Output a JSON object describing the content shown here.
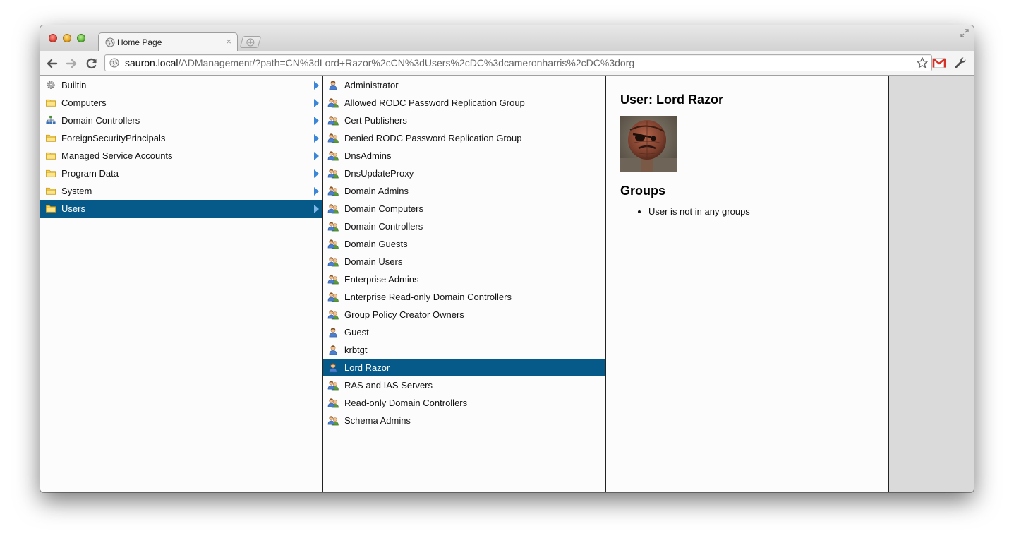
{
  "browser": {
    "tab": {
      "title": "Home Page",
      "close_glyph": "×"
    },
    "address": {
      "host": "sauron.local",
      "path": "/ADManagement/?path=CN%3dLord+Razor%2cCN%3dUsers%2cDC%3dcameronharris%2cDC%3dorg"
    }
  },
  "colors": {
    "selection": "#055a89",
    "arrow": "#3b86d6"
  },
  "containers": [
    {
      "label": "Builtin",
      "icon": "gear-icon"
    },
    {
      "label": "Computers",
      "icon": "folder-icon"
    },
    {
      "label": "Domain Controllers",
      "icon": "org-chart-icon"
    },
    {
      "label": "ForeignSecurityPrincipals",
      "icon": "folder-icon"
    },
    {
      "label": "Managed Service Accounts",
      "icon": "folder-icon"
    },
    {
      "label": "Program Data",
      "icon": "folder-icon"
    },
    {
      "label": "System",
      "icon": "folder-icon"
    },
    {
      "label": "Users",
      "icon": "folder-icon",
      "selected": true
    }
  ],
  "objects": [
    {
      "label": "Administrator",
      "icon": "user-icon"
    },
    {
      "label": "Allowed RODC Password Replication Group",
      "icon": "group-icon"
    },
    {
      "label": "Cert Publishers",
      "icon": "group-icon"
    },
    {
      "label": "Denied RODC Password Replication Group",
      "icon": "group-icon"
    },
    {
      "label": "DnsAdmins",
      "icon": "group-icon"
    },
    {
      "label": "DnsUpdateProxy",
      "icon": "group-icon"
    },
    {
      "label": "Domain Admins",
      "icon": "group-icon"
    },
    {
      "label": "Domain Computers",
      "icon": "group-icon"
    },
    {
      "label": "Domain Controllers",
      "icon": "group-icon"
    },
    {
      "label": "Domain Guests",
      "icon": "group-icon"
    },
    {
      "label": "Domain Users",
      "icon": "group-icon"
    },
    {
      "label": "Enterprise Admins",
      "icon": "group-icon"
    },
    {
      "label": "Enterprise Read-only Domain Controllers",
      "icon": "group-icon"
    },
    {
      "label": "Group Policy Creator Owners",
      "icon": "group-icon"
    },
    {
      "label": "Guest",
      "icon": "user-icon"
    },
    {
      "label": "krbtgt",
      "icon": "user-icon"
    },
    {
      "label": "Lord Razor",
      "icon": "user-icon",
      "selected": true
    },
    {
      "label": "RAS and IAS Servers",
      "icon": "group-icon"
    },
    {
      "label": "Read-only Domain Controllers",
      "icon": "group-icon"
    },
    {
      "label": "Schema Admins",
      "icon": "group-icon"
    }
  ],
  "detail": {
    "title": "User: Lord Razor",
    "groups_heading": "Groups",
    "groups": [
      "User is not in any groups"
    ]
  }
}
